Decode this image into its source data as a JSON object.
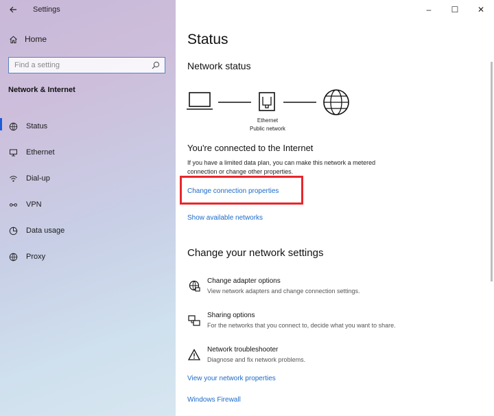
{
  "app": {
    "title": "Settings"
  },
  "sidebar": {
    "home_label": "Home",
    "search_placeholder": "Find a setting",
    "section_title": "Network & Internet",
    "items": [
      {
        "label": "Status",
        "icon": "status-icon",
        "active": true
      },
      {
        "label": "Ethernet",
        "icon": "ethernet-icon",
        "active": false
      },
      {
        "label": "Dial-up",
        "icon": "dialup-icon",
        "active": false
      },
      {
        "label": "VPN",
        "icon": "vpn-icon",
        "active": false
      },
      {
        "label": "Data usage",
        "icon": "data-usage-icon",
        "active": false
      },
      {
        "label": "Proxy",
        "icon": "proxy-icon",
        "active": false
      }
    ]
  },
  "window_controls": {
    "minimize": "–",
    "maximize": "☐",
    "close": "✕"
  },
  "main": {
    "title": "Status",
    "network_status_heading": "Network status",
    "diagram": {
      "adapter_name": "Ethernet",
      "network_type": "Public network"
    },
    "connected_heading": "You're connected to the Internet",
    "connected_desc": "If you have a limited data plan, you can make this network a metered connection or change other properties.",
    "link_change_props": "Change connection properties",
    "link_show_networks": "Show available networks",
    "change_heading": "Change your network settings",
    "settings": [
      {
        "title": "Change adapter options",
        "desc": "View network adapters and change connection settings.",
        "icon": "adapter-icon"
      },
      {
        "title": "Sharing options",
        "desc": "For the networks that you connect to, decide what you want to share.",
        "icon": "sharing-icon"
      },
      {
        "title": "Network troubleshooter",
        "desc": "Diagnose and fix network problems.",
        "icon": "warning-icon"
      }
    ],
    "link_view_props": "View your network properties",
    "link_firewall": "Windows Firewall"
  },
  "colors": {
    "accent": "#1e5bd8",
    "link": "#1b6ac9",
    "highlight": "#e8262b"
  }
}
